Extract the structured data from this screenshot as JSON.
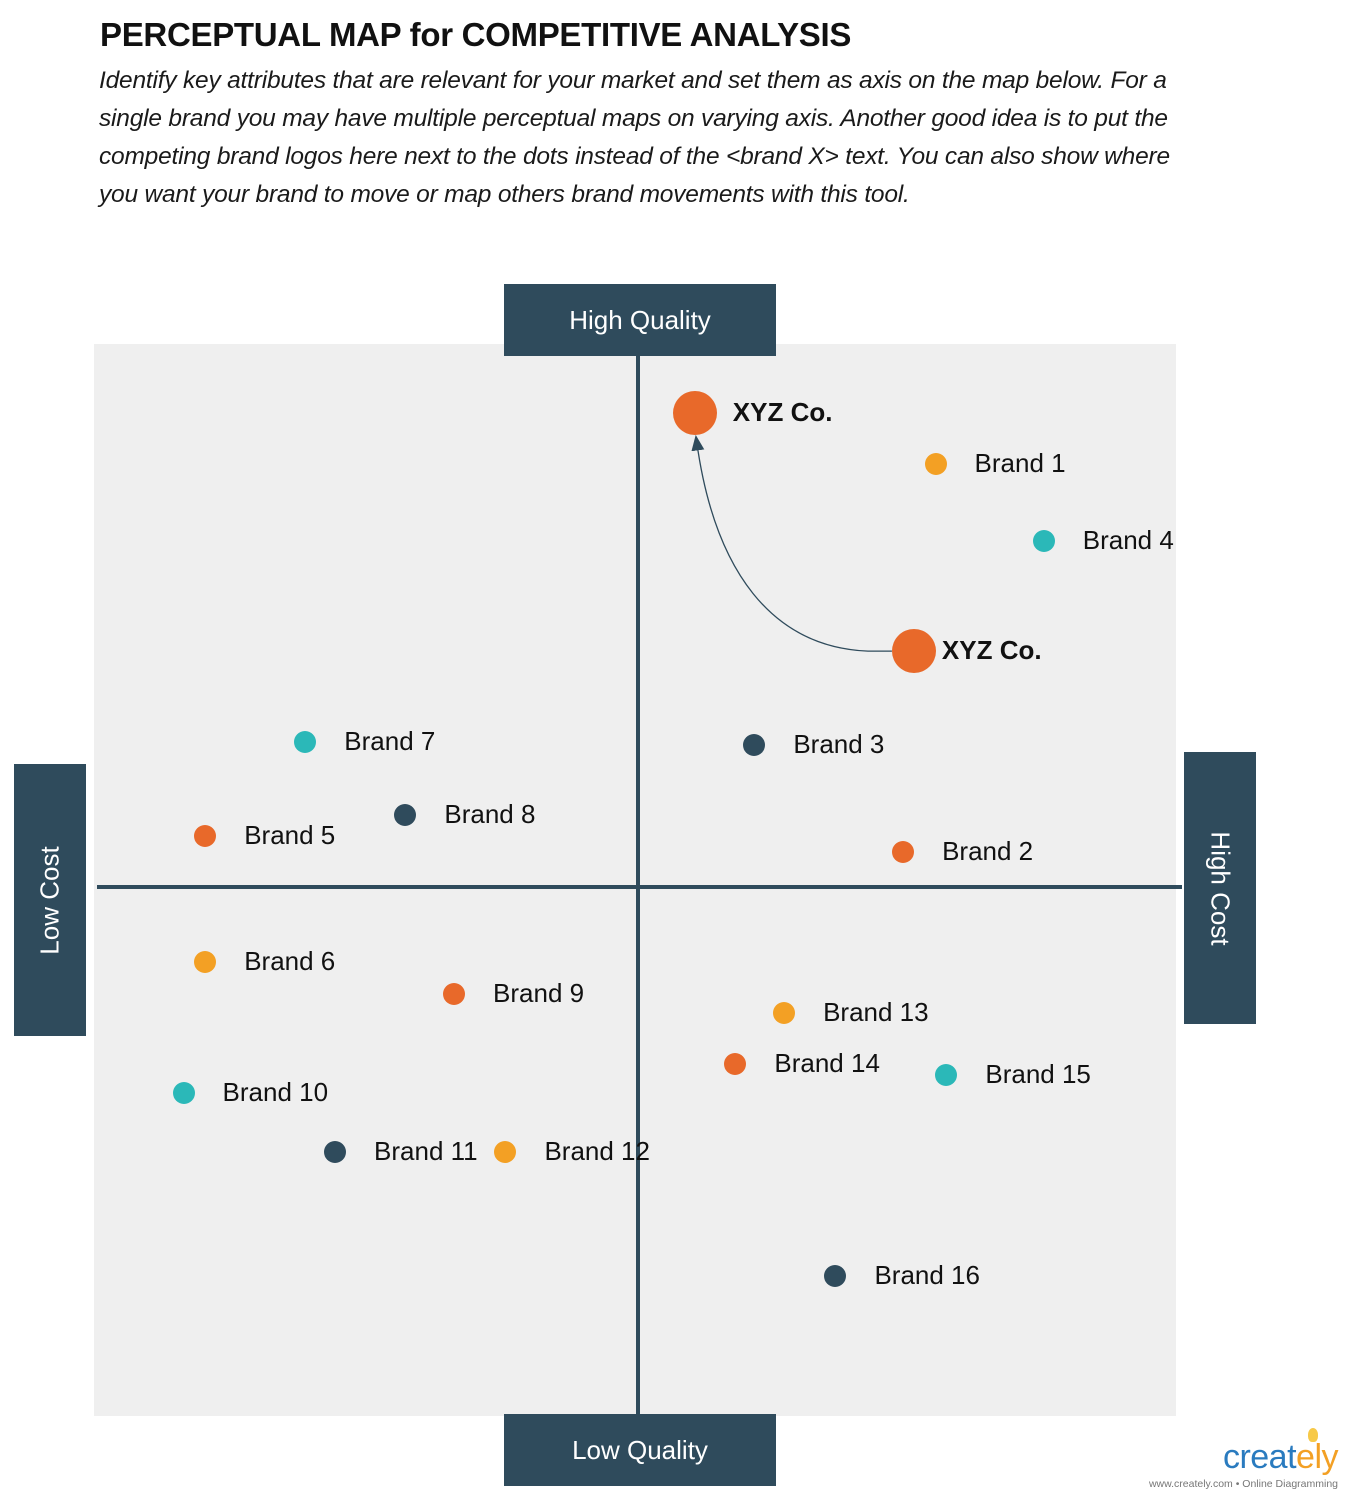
{
  "header": {
    "title": "PERCEPTUAL MAP for COMPETITIVE ANALYSIS",
    "description": "Identify key attributes that are relevant for your market and set them as axis on the map below. For a single brand you may have multiple perceptual maps on varying axis. Another good idea is to put the competing brand logos here next to the dots instead of the <brand X> text. You can also show where you want your brand to move or map others brand movements with this tool."
  },
  "axes": {
    "top": "High Quality",
    "bottom": "Low Quality",
    "left": "Low Cost",
    "right": "High Cost"
  },
  "colors": {
    "axis": "#2f4b5c",
    "orange": "#e8692a",
    "yellow": "#f3a024",
    "teal": "#2bb8b8",
    "slate": "#2f4b5c",
    "background": "#efefef"
  },
  "chart_data": {
    "type": "scatter",
    "title": "PERCEPTUAL MAP for COMPETITIVE ANALYSIS",
    "xlabel": "Cost (Low Cost → High Cost)",
    "ylabel": "Quality (Low Quality → High Quality)",
    "xlim": [
      -10,
      10
    ],
    "ylim": [
      -10,
      10
    ],
    "grid": false,
    "points": [
      {
        "label": "XYZ Co.",
        "x": 1.05,
        "y": 8.85,
        "color": "orange",
        "size": "large",
        "bold": true,
        "role": "target"
      },
      {
        "label": "XYZ Co.",
        "x": 5.1,
        "y": 4.4,
        "color": "orange",
        "size": "large",
        "bold": true,
        "role": "current"
      },
      {
        "label": "Brand 1",
        "x": 5.5,
        "y": 7.9,
        "color": "yellow"
      },
      {
        "label": "Brand 2",
        "x": 4.9,
        "y": 0.65,
        "color": "orange"
      },
      {
        "label": "Brand 3",
        "x": 2.15,
        "y": 2.65,
        "color": "slate"
      },
      {
        "label": "Brand 4",
        "x": 7.5,
        "y": 6.45,
        "color": "teal"
      },
      {
        "label": "Brand 5",
        "x": -8.0,
        "y": 0.95,
        "color": "orange"
      },
      {
        "label": "Brand 6",
        "x": -8.0,
        "y": -1.4,
        "color": "yellow"
      },
      {
        "label": "Brand 7",
        "x": -6.15,
        "y": 2.7,
        "color": "teal"
      },
      {
        "label": "Brand 8",
        "x": -4.3,
        "y": 1.35,
        "color": "slate"
      },
      {
        "label": "Brand 9",
        "x": -3.4,
        "y": -2.0,
        "color": "orange"
      },
      {
        "label": "Brand 10",
        "x": -8.4,
        "y": -3.85,
        "color": "teal"
      },
      {
        "label": "Brand 11",
        "x": -5.6,
        "y": -4.95,
        "color": "slate"
      },
      {
        "label": "Brand 12",
        "x": -2.45,
        "y": -4.95,
        "color": "yellow"
      },
      {
        "label": "Brand 13",
        "x": 2.7,
        "y": -2.35,
        "color": "yellow"
      },
      {
        "label": "Brand 14",
        "x": 1.8,
        "y": -3.3,
        "color": "orange"
      },
      {
        "label": "Brand 15",
        "x": 5.7,
        "y": -3.5,
        "color": "teal"
      },
      {
        "label": "Brand 16",
        "x": 3.65,
        "y": -7.25,
        "color": "slate"
      }
    ],
    "annotations": [
      {
        "type": "curved-arrow",
        "from": "XYZ Co. (current)",
        "to": "XYZ Co. (target)"
      }
    ]
  },
  "footer": {
    "logo_main": "creat",
    "logo_accent": "ely",
    "tagline": "www.creately.com • Online Diagramming"
  }
}
